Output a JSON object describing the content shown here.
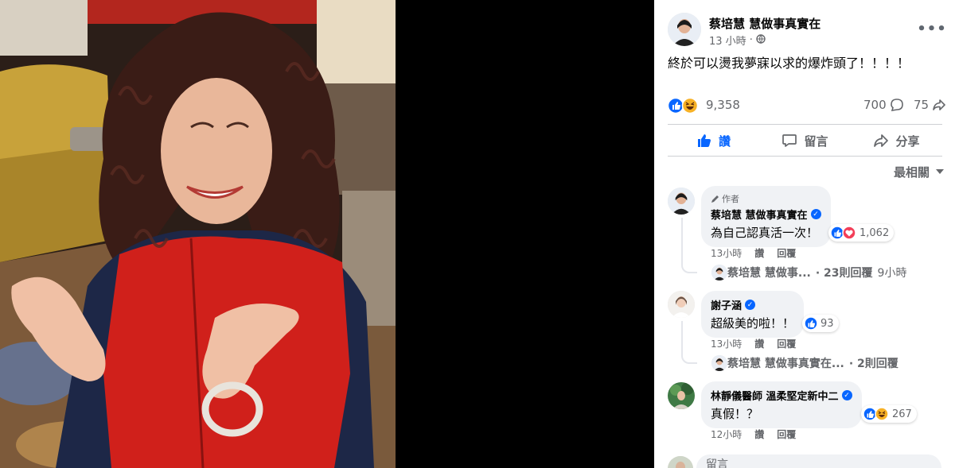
{
  "post": {
    "author": "蔡培慧 慧做事真實在",
    "time": "13 小時",
    "privacy_icon": "globe-icon",
    "text": "終於可以燙我夢寐以求的爆炸頭了！！！！",
    "reaction_count": "9,358",
    "comment_count": "700",
    "share_count": "75"
  },
  "actions": {
    "like": "讚",
    "comment": "留言",
    "share": "分享"
  },
  "sort_label": "最相關",
  "comments": [
    {
      "tag": "作者",
      "name": "蔡培慧 慧做事真實在",
      "text": "為自己認真活一次！",
      "reactions": "1,062",
      "time": "13小時",
      "like": "讚",
      "reply": "回覆",
      "reply_preview_name": "蔡培慧 慧做事...",
      "reply_count": "· 23則回覆",
      "reply_time": "9小時"
    },
    {
      "name": "謝子涵",
      "text": "超級美的啦！！",
      "reactions": "93",
      "time": "13小時",
      "like": "讚",
      "reply": "回覆",
      "reply_preview_name": "蔡培慧 慧做事真實在...",
      "reply_count": "· 2則回覆",
      "reply_time": ""
    },
    {
      "name": "林靜儀醫師 溫柔堅定新中二",
      "text": "真假！？",
      "reactions": "267",
      "time": "12小時",
      "like": "讚",
      "reply": "回覆"
    }
  ],
  "composer_placeholder": "留言",
  "colors": {
    "accent": "#0866ff",
    "secondary_text": "#65676b",
    "bubble": "#f0f2f5",
    "love": "#f33e58",
    "haha": "#f7b125"
  }
}
